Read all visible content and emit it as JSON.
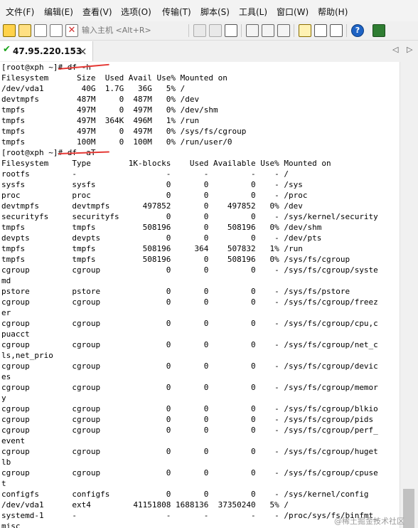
{
  "menu": [
    "文件(F)",
    "编辑(E)",
    "查看(V)",
    "选项(O)",
    "传输(T)",
    "脚本(S)",
    "工具(L)",
    "窗口(W)",
    "帮助(H)"
  ],
  "toolbar": {
    "host_placeholder": "输入主机 <Alt+R>",
    "icons": [
      "connect-icon",
      "quick-connect-icon",
      "reconnect-icon",
      "reconnect-all-icon",
      "disconnect-icon",
      "copy-icon",
      "paste-icon",
      "find-icon",
      "print-icon",
      "print-setup-icon",
      "print-screen-icon",
      "session-options-icon",
      "global-options-icon",
      "keymap-icon",
      "help-icon",
      "sftp-icon"
    ]
  },
  "tab": {
    "label": "47.95.220.153",
    "status": "connected"
  },
  "terminal": {
    "lines": [
      "[root@xph ~]# df -h",
      "Filesystem      Size  Used Avail Use% Mounted on",
      "/dev/vda1        40G  1.7G   36G   5% /",
      "devtmpfs        487M     0  487M   0% /dev",
      "tmpfs           497M     0  497M   0% /dev/shm",
      "tmpfs           497M  364K  496M   1% /run",
      "tmpfs           497M     0  497M   0% /sys/fs/cgroup",
      "tmpfs           100M     0  100M   0% /run/user/0",
      "[root@xph ~]# df -aT",
      "Filesystem     Type        1K-blocks    Used Available Use% Mounted on",
      "rootfs         -                   -       -         -    - /",
      "sysfs          sysfs               0       0         0    - /sys",
      "proc           proc                0       0         0    - /proc",
      "devtmpfs       devtmpfs       497852       0    497852   0% /dev",
      "securityfs     securityfs          0       0         0    - /sys/kernel/security",
      "tmpfs          tmpfs          508196       0    508196   0% /dev/shm",
      "devpts         devpts              0       0         0    - /dev/pts",
      "tmpfs          tmpfs          508196     364    507832   1% /run",
      "tmpfs          tmpfs          508196       0    508196   0% /sys/fs/cgroup",
      "cgroup         cgroup              0       0         0    - /sys/fs/cgroup/syste",
      "md",
      "pstore         pstore              0       0         0    - /sys/fs/pstore",
      "cgroup         cgroup              0       0         0    - /sys/fs/cgroup/freez",
      "er",
      "cgroup         cgroup              0       0         0    - /sys/fs/cgroup/cpu,c",
      "puacct",
      "cgroup         cgroup              0       0         0    - /sys/fs/cgroup/net_c",
      "ls,net_prio",
      "cgroup         cgroup              0       0         0    - /sys/fs/cgroup/devic",
      "es",
      "cgroup         cgroup              0       0         0    - /sys/fs/cgroup/memor",
      "y",
      "cgroup         cgroup              0       0         0    - /sys/fs/cgroup/blkio",
      "cgroup         cgroup              0       0         0    - /sys/fs/cgroup/pids",
      "cgroup         cgroup              0       0         0    - /sys/fs/cgroup/perf_",
      "event",
      "cgroup         cgroup              0       0         0    - /sys/fs/cgroup/huget",
      "lb",
      "cgroup         cgroup              0       0         0    - /sys/fs/cgroup/cpuse",
      "t",
      "configfs       configfs            0       0         0    - /sys/kernel/config",
      "/dev/vda1      ext4         41151808 1688136  37350240   5% /",
      "systemd-1      -                   -       -         -    - /proc/sys/fs/binfmt_",
      "misc"
    ]
  },
  "watermark": "@稀土掘金技术社区",
  "colors": {
    "annotation": "#e53935",
    "tab_check": "#1aa31a"
  }
}
